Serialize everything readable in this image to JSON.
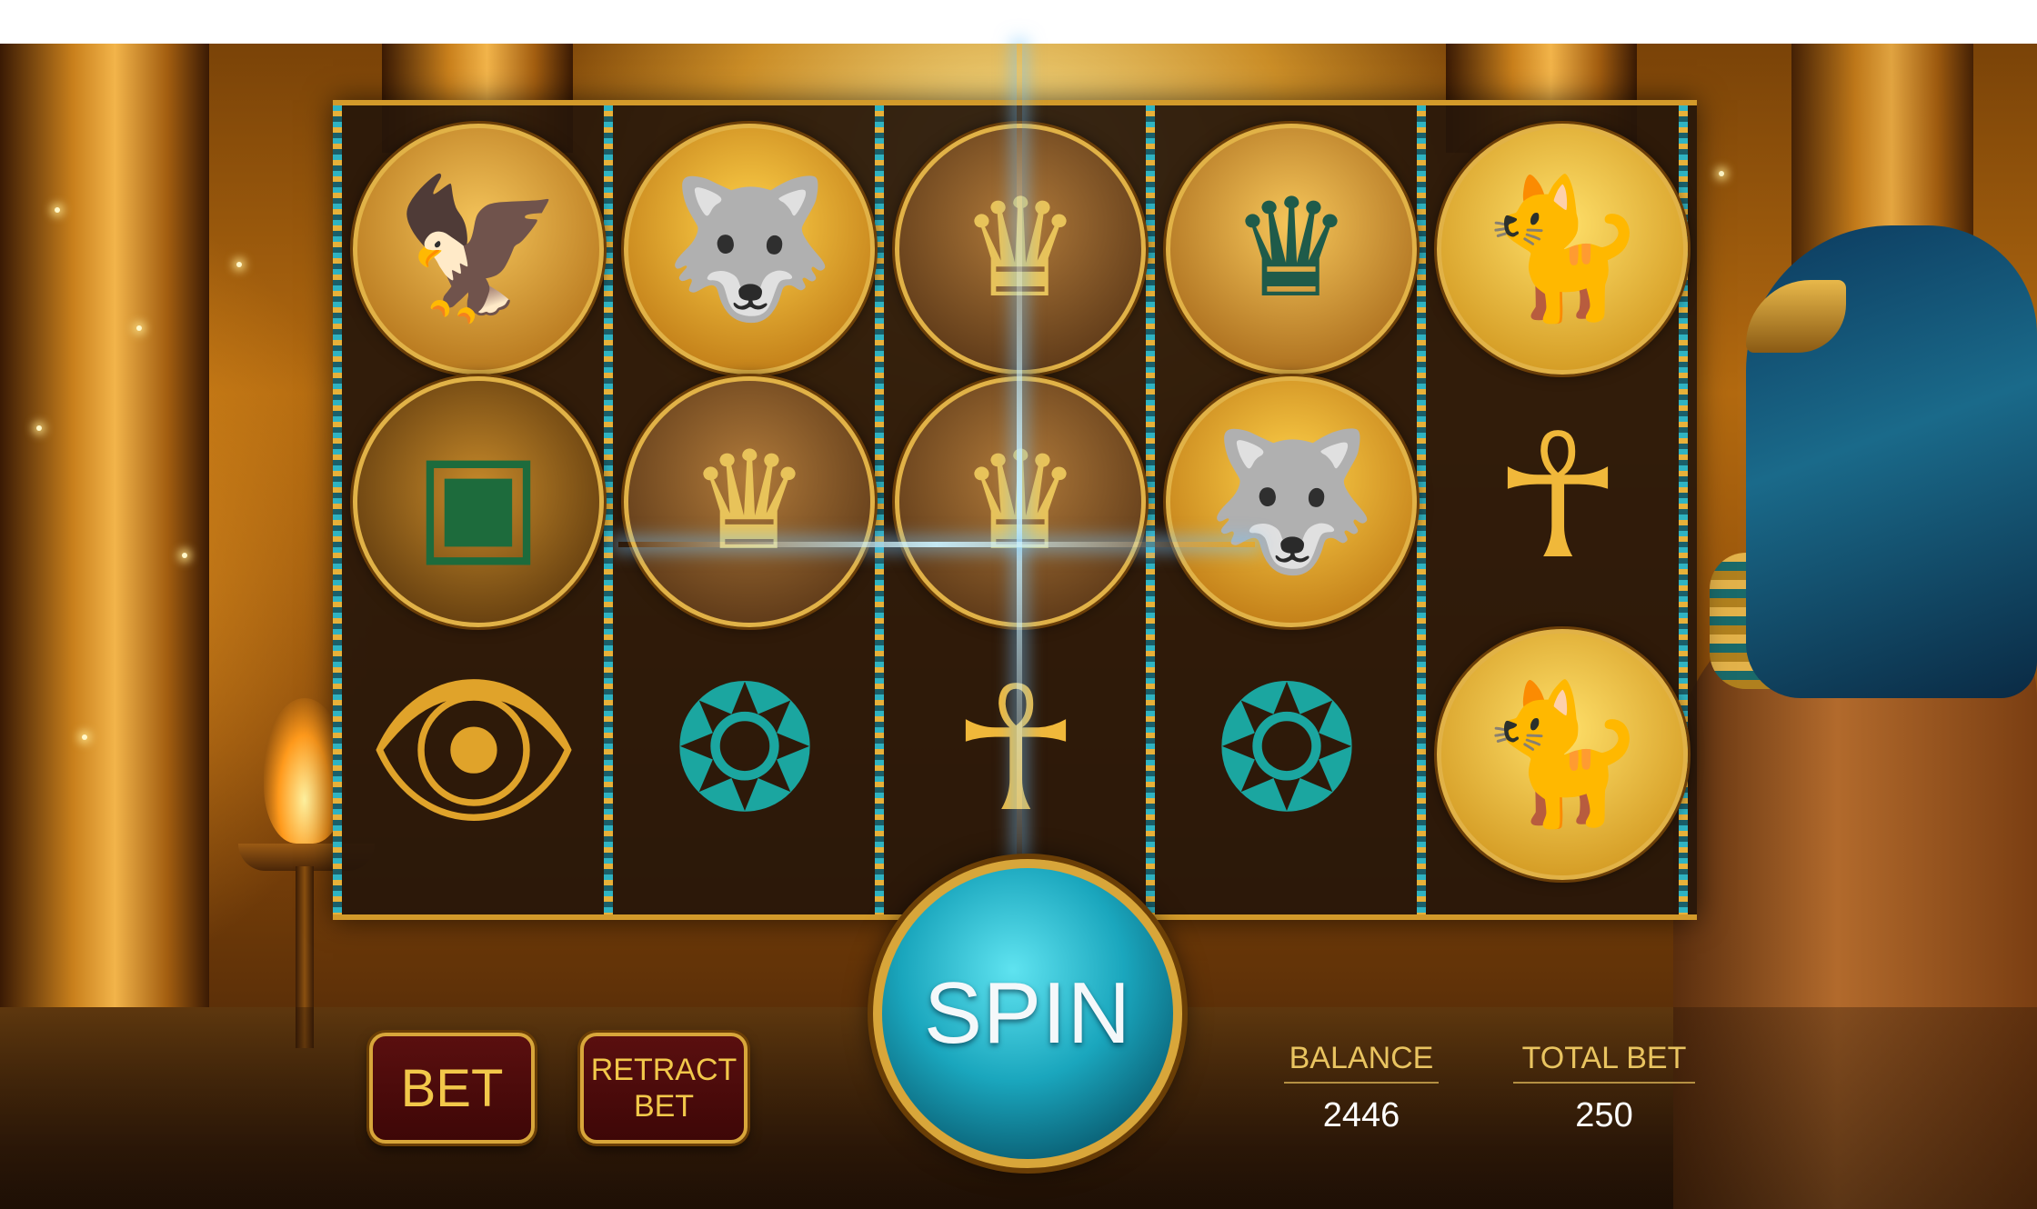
{
  "game": {
    "theme": "egyptian",
    "colors": {
      "gold": "#d8a63a",
      "button_red": "#4a0a0a",
      "spin_teal": "#1aa6bd",
      "reel_bg": "#26160a"
    }
  },
  "reels": [
    {
      "symbols": [
        "horus-icon",
        "scarab-book-icon",
        "eye-of-ra-icon"
      ]
    },
    {
      "symbols": [
        "anubis-icon",
        "pharaoh-icon",
        "winged-scarab-icon"
      ]
    },
    {
      "symbols": [
        "pharaoh-icon",
        "pharaoh-icon",
        "ankh-icon"
      ]
    },
    {
      "symbols": [
        "cleopatra-icon",
        "anubis-icon",
        "winged-scarab-icon"
      ]
    },
    {
      "symbols": [
        "bastet-icon",
        "ankh-icon",
        "bastet-icon"
      ]
    }
  ],
  "controls": {
    "bet_label": "BET",
    "retract_line1": "RETRACT",
    "retract_line2": "BET",
    "spin_label": "SPIN"
  },
  "stats": {
    "balance_label": "BALANCE",
    "balance_value": "2446",
    "total_bet_label": "TOTAL BET",
    "total_bet_value": "250"
  }
}
